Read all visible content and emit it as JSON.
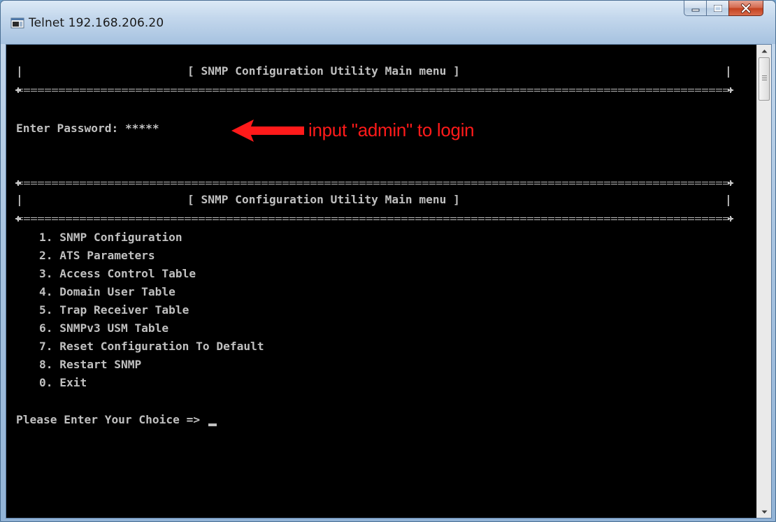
{
  "window": {
    "title": "Telnet 192.168.206.20",
    "icon": "telnet-app-icon"
  },
  "caption_buttons": {
    "minimize_icon": "minimize-icon",
    "maximize_icon": "maximize-icon",
    "close_icon": "close-icon"
  },
  "terminal": {
    "border_char": "|",
    "header1_title": "[ SNMP Configuration Utility Main menu ]",
    "password_prompt": "Enter Password: ",
    "password_mask": "*****",
    "header2_title": "[ SNMP Configuration Utility Main menu ]",
    "menu_items": [
      "1. SNMP Configuration",
      "2. ATS Parameters",
      "3. Access Control Table",
      "4. Domain User Table",
      "5. Trap Receiver Table",
      "6. SNMPv3 USM Table",
      "7. Reset Configuration To Default",
      "8. Restart SNMP",
      "0. Exit"
    ],
    "choice_prompt": "Please Enter Your Choice => "
  },
  "annotation": {
    "text": "input \"admin\" to login",
    "color": "#ff1a1a"
  },
  "colors": {
    "terminal_bg": "#000000",
    "terminal_fg": "#c0c0c0"
  }
}
